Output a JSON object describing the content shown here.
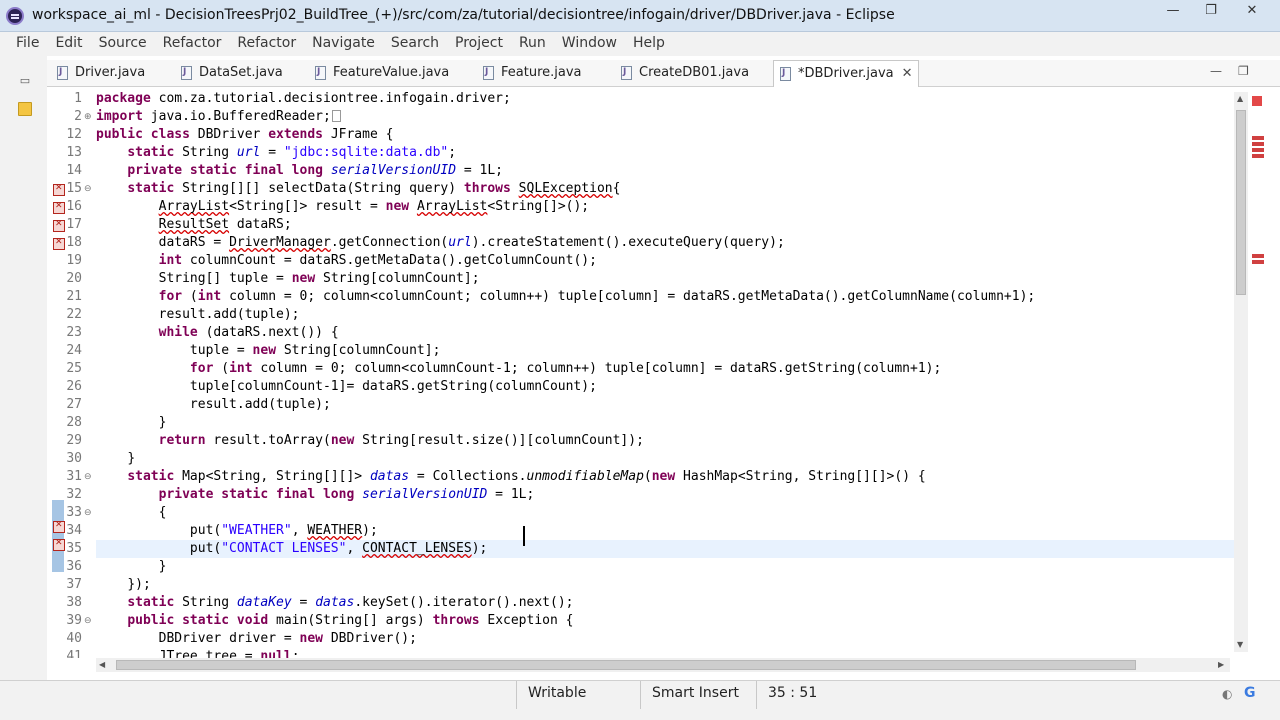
{
  "window": {
    "title": "workspace_ai_ml - DecisionTreesPrj02_BuildTree_(+)/src/com/za/tutorial/decisiontree/infogain/driver/DBDriver.java - Eclipse",
    "controls": {
      "minimize": "—",
      "maximize": "❐",
      "close": "✕"
    }
  },
  "menu": [
    "File",
    "Edit",
    "Source",
    "Refactor",
    "Refactor",
    "Navigate",
    "Search",
    "Project",
    "Run",
    "Window",
    "Help"
  ],
  "tabs": [
    {
      "label": "Driver.java",
      "active": false
    },
    {
      "label": "DataSet.java",
      "active": false
    },
    {
      "label": "FeatureValue.java",
      "active": false
    },
    {
      "label": "Feature.java",
      "active": false
    },
    {
      "label": "CreateDB01.java",
      "active": false
    },
    {
      "label": "*DBDriver.java",
      "active": true
    }
  ],
  "editor": {
    "caret_position": "35 : 51",
    "lines": [
      {
        "n": "1"
      },
      {
        "n": "2"
      },
      {
        "n": "12"
      },
      {
        "n": "13"
      },
      {
        "n": "14"
      },
      {
        "n": "15"
      },
      {
        "n": "16"
      },
      {
        "n": "17"
      },
      {
        "n": "18"
      },
      {
        "n": "19"
      },
      {
        "n": "20"
      },
      {
        "n": "21"
      },
      {
        "n": "22"
      },
      {
        "n": "23"
      },
      {
        "n": "24"
      },
      {
        "n": "25"
      },
      {
        "n": "26"
      },
      {
        "n": "27"
      },
      {
        "n": "28"
      },
      {
        "n": "29"
      },
      {
        "n": "30"
      },
      {
        "n": "31"
      },
      {
        "n": "32"
      },
      {
        "n": "33"
      },
      {
        "n": "34"
      },
      {
        "n": "35"
      },
      {
        "n": "36"
      },
      {
        "n": "37"
      },
      {
        "n": "38"
      },
      {
        "n": "39"
      },
      {
        "n": "40"
      },
      {
        "n": "41"
      }
    ],
    "code": {
      "l1_kw": "package",
      "l1_rest": " com.za.tutorial.decisiontree.infogain.driver;",
      "l2_kw": "import",
      "l2_rest": " java.io.BufferedReader;",
      "l12_kw1": "public class",
      "l12_mid": " DBDriver ",
      "l12_kw2": "extends",
      "l12_rest": " JFrame {",
      "l13_kw": "static",
      "l13_a": " String ",
      "l13_fld": "url",
      "l13_b": " = ",
      "l13_str": "\"jdbc:sqlite:data.db\"",
      "l13_c": ";",
      "l14_kw": "private static final long",
      "l14_a": " ",
      "l14_fld": "serialVersionUID",
      "l14_b": " = 1L;",
      "l15_kw": "static",
      "l15_a": " String[][] selectData(String query) ",
      "l15_kw2": "throws",
      "l15_b": " ",
      "l15_sq": "SQLException",
      "l15_c": "{",
      "l16_sq1": "ArrayList",
      "l16_a": "<String[]> result = ",
      "l16_kw": "new",
      "l16_b": " ",
      "l16_sq2": "ArrayList",
      "l16_c": "<String[]>();",
      "l17_sq": "ResultSet",
      "l17_a": " dataRS;",
      "l18_a": "dataRS = ",
      "l18_sq": "DriverManager",
      "l18_b": ".getConnection(",
      "l18_fld": "url",
      "l18_c": ").createStatement().executeQuery(query);",
      "l19_kw": "int",
      "l19_a": " columnCount = dataRS.getMetaData().getColumnCount();",
      "l20_a": "String[] tuple = ",
      "l20_kw": "new",
      "l20_b": " String[columnCount];",
      "l21_kw": "for",
      "l21_a": " (",
      "l21_kw2": "int",
      "l21_b": " column = 0; column<columnCount; column++) tuple[column] = dataRS.getMetaData().getColumnName(column+1);",
      "l22_a": "result.add(tuple);",
      "l23_kw": "while",
      "l23_a": " (dataRS.next()) {",
      "l24_a": "tuple = ",
      "l24_kw": "new",
      "l24_b": " String[columnCount];",
      "l25_kw": "for",
      "l25_a": " (",
      "l25_kw2": "int",
      "l25_b": " column = 0; column<columnCount-1; column++) tuple[column] = dataRS.getString(column+1);",
      "l26_a": "tuple[columnCount-1]= dataRS.getString(columnCount);",
      "l27_a": "result.add(tuple);",
      "l28_a": "}",
      "l29_kw": "return",
      "l29_a": " result.toArray(",
      "l29_kw2": "new",
      "l29_b": " String[result.size()][columnCount]);",
      "l30_a": "}",
      "l31_kw": "static",
      "l31_a": " Map<String, String[][]> ",
      "l31_fld": "datas",
      "l31_b": " = Collections.",
      "l31_fld2": "unmodifiableMap",
      "l31_c": "(",
      "l31_kw2": "new",
      "l31_d": " HashMap<String, String[][]>() {",
      "l32_kw": "private static final long",
      "l32_a": " ",
      "l32_fld": "serialVersionUID",
      "l32_b": " = 1L;",
      "l33_a": "{",
      "l34_a": "put(",
      "l34_str": "\"WEATHER\"",
      "l34_b": ", ",
      "l34_sq": "WEATHER",
      "l34_c": ");",
      "l35_a": "put(",
      "l35_str": "\"CONTACT LENSES\"",
      "l35_b": ", ",
      "l35_sq": "CONTACT_LENSES",
      "l35_c": ");",
      "l36_a": "}",
      "l37_a": "});",
      "l38_kw": "static",
      "l38_a": " String ",
      "l38_fld": "dataKey",
      "l38_b": " = ",
      "l38_fld2": "datas",
      "l38_c": ".keySet().iterator().next();",
      "l39_kw": "public static void",
      "l39_a": " main(String[] args) ",
      "l39_kw2": "throws",
      "l39_b": " Exception {",
      "l40_a": "DBDriver driver = ",
      "l40_kw": "new",
      "l40_b": " DBDriver();",
      "l41_a": "JTree tree = ",
      "l41_kw": "null",
      "l41_b": ";"
    }
  },
  "status": {
    "writable": "Writable",
    "insert_mode": "Smart Insert",
    "position": "35 : 51"
  },
  "colors": {
    "keyword": "#7f0055",
    "string": "#2a00ff",
    "field": "#0000c0",
    "error": "#d60000",
    "current_line": "#e8f2fe"
  }
}
